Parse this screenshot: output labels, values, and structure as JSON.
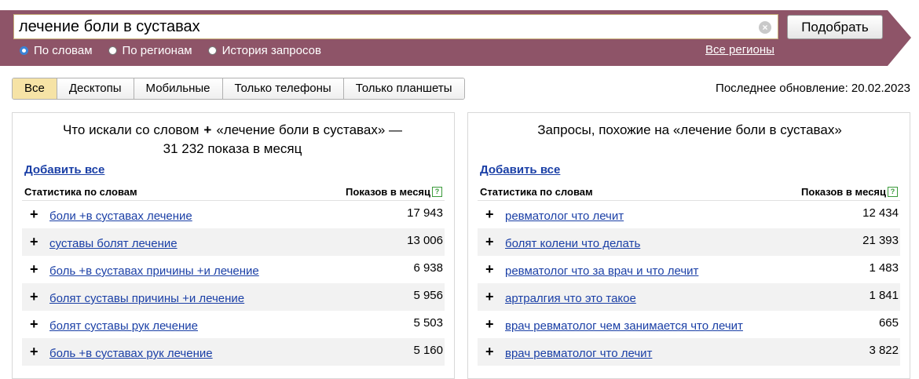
{
  "search": {
    "query": "лечение боли в суставах",
    "button_label": "Подобрать",
    "modes": [
      {
        "label": "По словам",
        "checked": true
      },
      {
        "label": "По регионам",
        "checked": false
      },
      {
        "label": "История запросов",
        "checked": false
      }
    ],
    "regions_link": "Все регионы"
  },
  "tabs": [
    {
      "label": "Все",
      "active": true
    },
    {
      "label": "Десктопы",
      "active": false
    },
    {
      "label": "Мобильные",
      "active": false
    },
    {
      "label": "Только телефоны",
      "active": false
    },
    {
      "label": "Только планшеты",
      "active": false
    }
  ],
  "last_update": "Последнее обновление: 20.02.2023",
  "left_panel": {
    "title_part1": "Что искали со словом",
    "title_part2": "«лечение боли в суставах» — 31 232 показа в месяц",
    "add_all": "Добавить все",
    "col_words": "Статистика по словам",
    "col_count": "Показов в месяц",
    "rows": [
      {
        "phrase": "боли +в суставах лечение",
        "count": "17 943"
      },
      {
        "phrase": "суставы болят лечение",
        "count": "13 006"
      },
      {
        "phrase": "боль +в суставах причины +и лечение",
        "count": "6 938"
      },
      {
        "phrase": "болят суставы причины +и лечение",
        "count": "5 956"
      },
      {
        "phrase": "болят суставы рук лечение",
        "count": "5 503"
      },
      {
        "phrase": "боль +в суставах рук лечение",
        "count": "5 160"
      }
    ]
  },
  "right_panel": {
    "title": "Запросы, похожие на «лечение боли в суставах»",
    "add_all": "Добавить все",
    "col_words": "Статистика по словам",
    "col_count": "Показов в месяц",
    "rows": [
      {
        "phrase": "ревматолог что лечит",
        "count": "12 434"
      },
      {
        "phrase": "болят колени что делать",
        "count": "21 393"
      },
      {
        "phrase": "ревматолог что за врач и что лечит",
        "count": "1 483"
      },
      {
        "phrase": "артралгия что это такое",
        "count": "1 841"
      },
      {
        "phrase": "врач ревматолог чем занимается что лечит",
        "count": "665"
      },
      {
        "phrase": "врач ревматолог что лечит",
        "count": "3 822"
      }
    ]
  },
  "colors": {
    "header_bg": "#8e5468",
    "link": "#1a3fa6",
    "active_tab": "#f6e3a6"
  }
}
